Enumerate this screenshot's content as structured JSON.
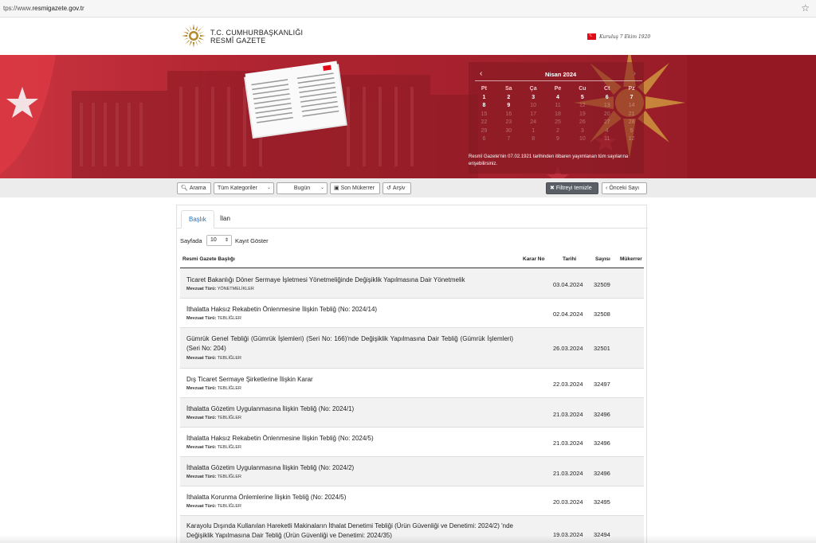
{
  "browser": {
    "url_prefix": "tps://www.",
    "url_host": "resmigazete.gov.tr"
  },
  "header": {
    "title_line1": "T.C. CUMHURBAŞKANLIĞI",
    "title_line2": "RESMÎ GAZETE",
    "motto": "Kuruluş 7 Ekim 1920",
    "flag_color": "#e30a17"
  },
  "calendar": {
    "month_label": "Nisan 2024",
    "weekdays": [
      "Pt",
      "Sa",
      "Ça",
      "Pe",
      "Cu",
      "Ct",
      "Pz"
    ],
    "weeks": [
      [
        "1",
        "2",
        "3",
        "4",
        "5",
        "6",
        "7"
      ],
      [
        "8",
        "9",
        "10",
        "11",
        "12",
        "13",
        "14"
      ],
      [
        "15",
        "16",
        "17",
        "18",
        "19",
        "20",
        "21"
      ],
      [
        "22",
        "23",
        "24",
        "25",
        "26",
        "27",
        "28"
      ],
      [
        "29",
        "30",
        "1",
        "2",
        "3",
        "4",
        "5"
      ],
      [
        "6",
        "7",
        "8",
        "9",
        "10",
        "11",
        "12"
      ]
    ],
    "note": "Resmî Gazete'nin 07.02.1921 tarihinden itibaren yayımlanan tüm sayılarına erişebilirsiniz."
  },
  "toolbar": {
    "search": "Arama",
    "category": "Tüm Kategoriler",
    "date": "Bugün",
    "last_duplicate": "Son Mükerrer",
    "archive": "Arşiv",
    "clear_filter": "Filtreyi temizle",
    "previous_issue": "Önceki Sayı"
  },
  "tabs": [
    "Başlık",
    "İlan"
  ],
  "length_menu": {
    "before": "Sayfada",
    "value": "10",
    "after": "Kayıt Göster"
  },
  "table": {
    "headers": {
      "title": "Resmi Gazete Başlığı",
      "decision_no": "Karar No",
      "date": "Tarihi",
      "issue": "Sayısı",
      "duplicate": "Mükerrer"
    },
    "meta_label": "Mevzuat Türü:",
    "rows": [
      {
        "title": "Ticaret Bakanlığı Döner Sermaye İşletmesi Yönetmeliğinde Değişiklik Yapılmasına Dair Yönetmelik",
        "type": "YÖNETMELİKLER",
        "date": "03.04.2024",
        "issue": "32509"
      },
      {
        "title": "İthalatta Haksız Rekabetin Önlenmesine İlişkin Tebliğ (No: 2024/14)",
        "type": "TEBLİĞLER",
        "date": "02.04.2024",
        "issue": "32508"
      },
      {
        "title": "Gümrük Genel Tebliği (Gümrük İşlemleri) (Seri No: 166)'nde Değişiklik Yapılmasına Dair Tebliğ (Gümrük İşlemleri) (Seri No: 204)",
        "type": "TEBLİĞLER",
        "date": "26.03.2024",
        "issue": "32501"
      },
      {
        "title": "Dış Ticaret Sermaye Şirketlerine İlişkin Karar",
        "type": "TEBLİĞLER",
        "date": "22.03.2024",
        "issue": "32497"
      },
      {
        "title": "İthalatta Gözetim Uygulanmasına İlişkin Tebliğ (No: 2024/1)",
        "type": "TEBLİĞLER",
        "date": "21.03.2024",
        "issue": "32496"
      },
      {
        "title": "İthalatta Haksız Rekabetin Önlenmesine İlişkin Tebliğ (No: 2024/5)",
        "type": "TEBLİĞLER",
        "date": "21.03.2024",
        "issue": "32496"
      },
      {
        "title": "İthalatta Gözetim Uygulanmasına İlişkin Tebliğ (No: 2024/2)",
        "type": "TEBLİĞLER",
        "date": "21.03.2024",
        "issue": "32496"
      },
      {
        "title": "İthalatta Korunma Önlemlerine İlişkin Tebliğ (No: 2024/5)",
        "type": "TEBLİĞLER",
        "date": "20.03.2024",
        "issue": "32495"
      },
      {
        "title": "Karayolu Dışında Kullanılan Hareketli Makinaların İthalat Denetimi Tebliği (Ürün Güvenliği ve Denetimi: 2024/2) 'nde Değişiklik Yapılmasına Dair Tebliğ (Ürün Güvenliği ve Denetimi: 2024/35)",
        "type": "",
        "date": "19.03.2024",
        "issue": "32494"
      }
    ]
  }
}
